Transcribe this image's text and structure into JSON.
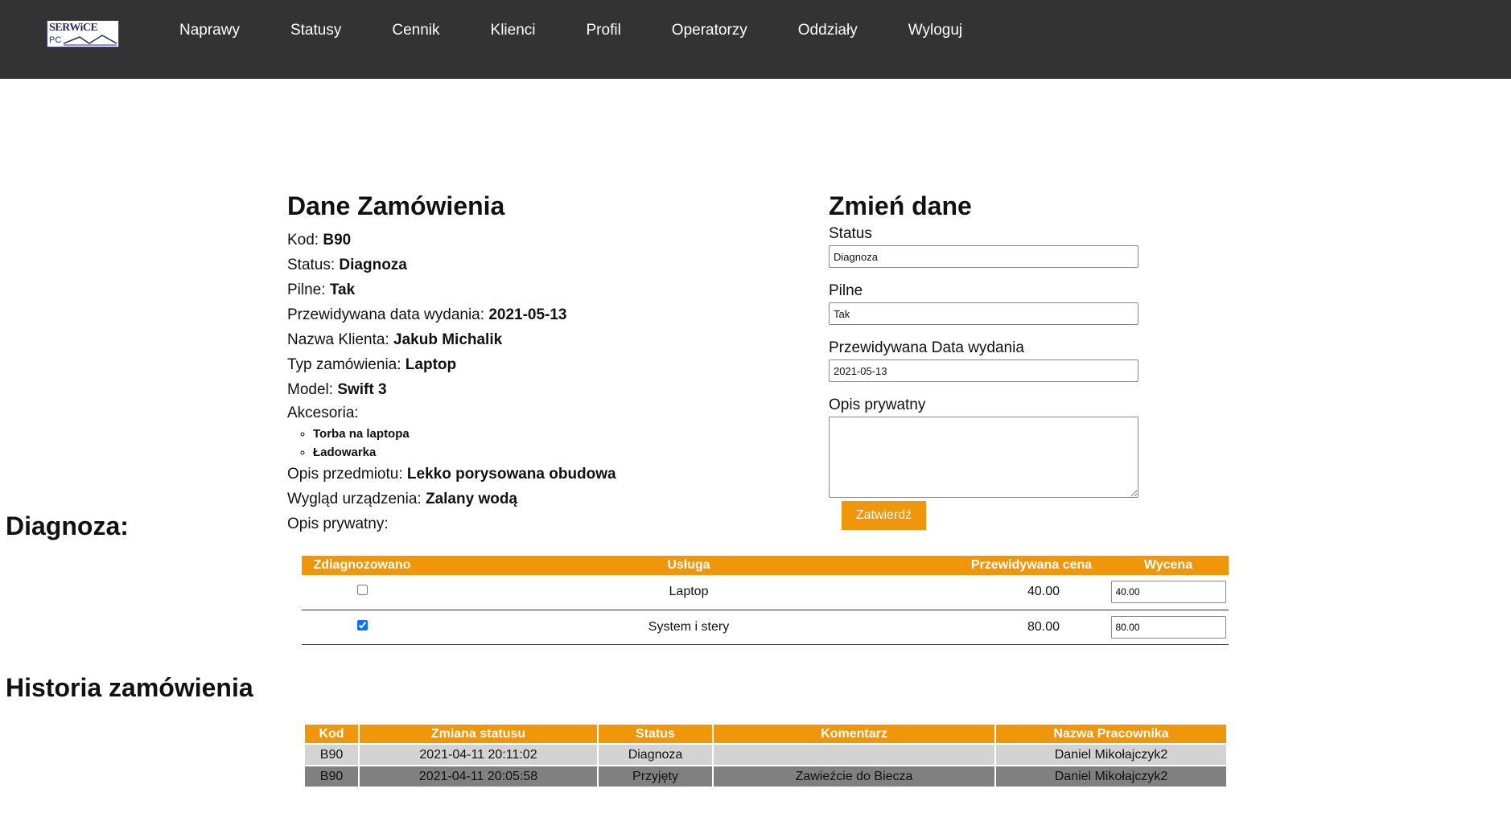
{
  "logo": {
    "line1": "SERWiCE",
    "line2": "PC"
  },
  "nav": [
    "Naprawy",
    "Statusy",
    "Cennik",
    "Klienci",
    "Profil",
    "Operatorzy",
    "Oddziały",
    "Wyloguj"
  ],
  "order": {
    "title": "Dane Zamówienia",
    "kod_label": "Kod: ",
    "kod": "B90",
    "status_label": "Status: ",
    "status": "Diagnoza",
    "pilne_label": "Pilne: ",
    "pilne": "Tak",
    "data_label": "Przewidywana data wydania: ",
    "data": "2021-05-13",
    "klient_label": "Nazwa Klienta: ",
    "klient": "Jakub Michalik",
    "typ_label": "Typ zamówienia: ",
    "typ": "Laptop",
    "model_label": "Model: ",
    "model": "Swift 3",
    "akcesoria_label": "Akcesoria:",
    "akcesoria": [
      "Torba na laptopa",
      "Ładowarka"
    ],
    "opis_przedmiotu_label": "Opis przedmiotu: ",
    "opis_przedmiotu": "Lekko porysowana obudowa",
    "wyglad_label": "Wygląd urządzenia: ",
    "wyglad": "Zalany wodą",
    "opis_prywatny_label": "Opis prywatny:"
  },
  "edit": {
    "title": "Zmień dane",
    "status_label": "Status",
    "status_value": "Diagnoza",
    "pilne_label": "Pilne",
    "pilne_value": "Tak",
    "data_label": "Przewidywana Data wydania",
    "data_value": "2021-05-13",
    "opis_label": "Opis prywatny",
    "opis_value": "",
    "submit": "Zatwierdź"
  },
  "diagnoza": {
    "title": "Diagnoza:",
    "headers": [
      "Zdiagnozowano",
      "Usługa",
      "Przewidywana cena",
      "Wycena"
    ],
    "rows": [
      {
        "checked": false,
        "usluga": "Laptop",
        "cena": "40.00",
        "wycena": "40.00"
      },
      {
        "checked": true,
        "usluga": "System i stery",
        "cena": "80.00",
        "wycena": "80.00"
      }
    ]
  },
  "historia": {
    "title": "Historia zamówienia",
    "headers": [
      "Kod",
      "Zmiana statusu",
      "Status",
      "Komentarz",
      "Nazwa Pracownika"
    ],
    "rows": [
      {
        "kod": "B90",
        "zmiana": "2021-04-11 20:11:02",
        "status": "Diagnoza",
        "komentarz": "",
        "pracownik": "Daniel Mikołajczyk2"
      },
      {
        "kod": "B90",
        "zmiana": "2021-04-11 20:05:58",
        "status": "Przyjęty",
        "komentarz": "Zawieźcie do Biecza",
        "pracownik": "Daniel Mikołajczyk2"
      }
    ]
  },
  "colors": {
    "accent": "#f0960b",
    "nav_bg": "#333333",
    "row_light": "#d3d3d3",
    "row_dark": "#808080"
  }
}
